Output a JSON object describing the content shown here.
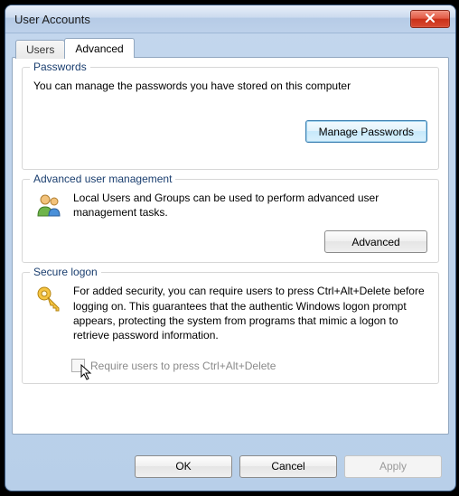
{
  "window": {
    "title": "User Accounts"
  },
  "tabs": {
    "users": "Users",
    "advanced": "Advanced"
  },
  "passwords": {
    "title": "Passwords",
    "text": "You can manage the passwords you have stored on this computer",
    "button": "Manage Passwords"
  },
  "advancedMgmt": {
    "title": "Advanced user management",
    "text": "Local Users and Groups can be used to perform advanced user management tasks.",
    "button": "Advanced"
  },
  "secureLogon": {
    "title": "Secure logon",
    "text": "For added security, you can require users to press Ctrl+Alt+Delete before logging on. This guarantees that the authentic Windows logon prompt appears, protecting the system from programs that mimic a logon to retrieve password information.",
    "checkboxLabel": "Require users to press Ctrl+Alt+Delete"
  },
  "footer": {
    "ok": "OK",
    "cancel": "Cancel",
    "apply": "Apply"
  }
}
